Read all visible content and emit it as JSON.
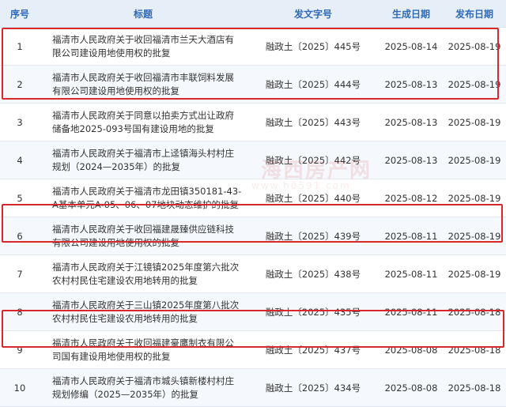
{
  "table": {
    "headers": [
      "序号",
      "标题",
      "发文字号",
      "生成日期",
      "发布日期"
    ],
    "rows": [
      {
        "idx": "1",
        "title": "福清市人民政府关于收回福清市兰天大酒店有限公司建设用地使用权的批复",
        "code": "融政土〔2025〕445号",
        "gen": "2025-08-14",
        "pub": "2025-08-19",
        "highlighted": true
      },
      {
        "idx": "2",
        "title": "福清市人民政府关于收回福清市丰联饲料发展有限公司建设用地使用权的批复",
        "code": "融政土〔2025〕444号",
        "gen": "2025-08-13",
        "pub": "2025-08-19",
        "highlighted": true
      },
      {
        "idx": "3",
        "title": "福清市人民政府关于同意以拍卖方式出让政府储备地2025-093号国有建设用地的批复",
        "code": "融政土〔2025〕443号",
        "gen": "2025-08-13",
        "pub": "2025-08-19",
        "highlighted": false
      },
      {
        "idx": "4",
        "title": "福清市人民政府关于福清市上迳镇海头村村庄规划（2024—2035年）的批复",
        "code": "融政土〔2025〕442号",
        "gen": "2025-08-13",
        "pub": "2025-08-19",
        "highlighted": false
      },
      {
        "idx": "5",
        "title": "福清市人民政府关于福清市龙田镇350181-43-A基本单元A-05、06、07地块动态维护的批复",
        "code": "融政土〔2025〕440号",
        "gen": "2025-08-12",
        "pub": "2025-08-19",
        "highlighted": false
      },
      {
        "idx": "6",
        "title": "福清市人民政府关于收回福建晟臻供应链科技有限公司建设用地使用权的批复",
        "code": "融政土〔2025〕439号",
        "gen": "2025-08-11",
        "pub": "2025-08-19",
        "highlighted": true
      },
      {
        "idx": "7",
        "title": "福清市人民政府关于江镜镇2025年度第六批次农村村民住宅建设农用地转用的批复",
        "code": "融政土〔2025〕438号",
        "gen": "2025-08-11",
        "pub": "2025-08-19",
        "highlighted": false
      },
      {
        "idx": "8",
        "title": "福清市人民政府关于三山镇2025年度第八批次农村村民住宅建设农用地转用的批复",
        "code": "融政土〔2025〕435号",
        "gen": "2025-08-11",
        "pub": "2025-08-18",
        "highlighted": false
      },
      {
        "idx": "9",
        "title": "福清市人民政府关于收回福建豪鹰制衣有限公司国有建设用地使用权的批复",
        "code": "融政土〔2025〕437号",
        "gen": "2025-08-08",
        "pub": "2025-08-18",
        "highlighted": true
      },
      {
        "idx": "10",
        "title": "福清市人民政府关于福清市城头镇新楼村村庄规划修编（2025—2035年）的批复",
        "code": "融政土〔2025〕434号",
        "gen": "2025-08-08",
        "pub": "2025-08-18",
        "highlighted": false
      }
    ]
  },
  "watermark": {
    "text": "海西房产网",
    "url": "www.h0591.com"
  },
  "colors": {
    "header_bg": "#e6eef8",
    "header_text": "#2f6bb8",
    "highlight_border": "#d9282c"
  }
}
